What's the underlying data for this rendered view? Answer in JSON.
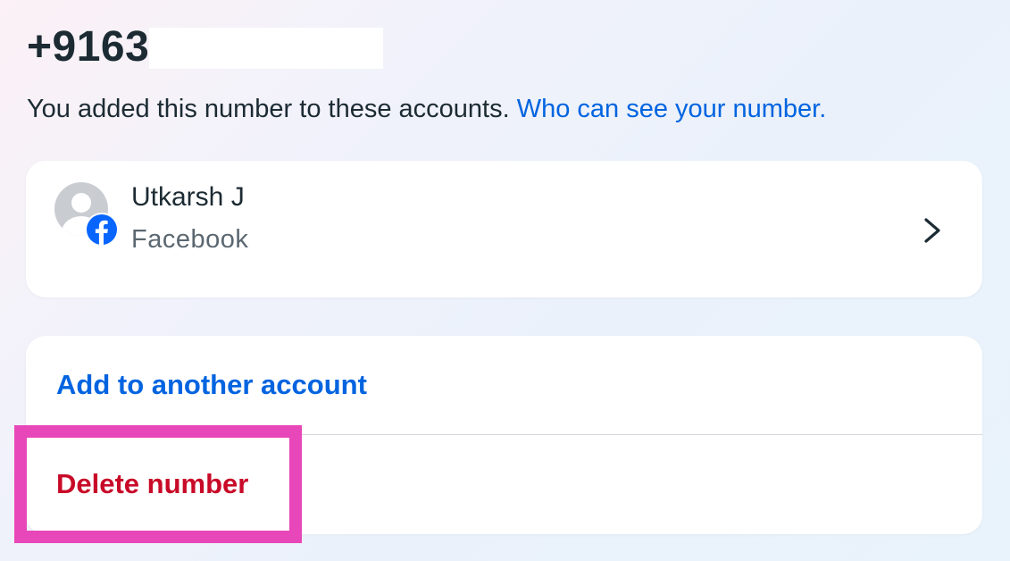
{
  "phone": {
    "number_prefix": "+9163"
  },
  "subtitle": {
    "text": "You added this number to these accounts.",
    "link": "Who can see your number."
  },
  "account": {
    "name": "Utkarsh J",
    "platform": "Facebook",
    "avatar_icon": "default-avatar-icon",
    "badge_icon": "facebook-icon",
    "chevron_icon": "chevron-right-icon"
  },
  "actions": {
    "add_label": "Add to another account",
    "delete_label": "Delete number"
  },
  "colors": {
    "link_blue": "#0064e0",
    "danger_red": "#c80a28",
    "facebook_blue": "#0866ff",
    "highlight": "#e847b9"
  }
}
